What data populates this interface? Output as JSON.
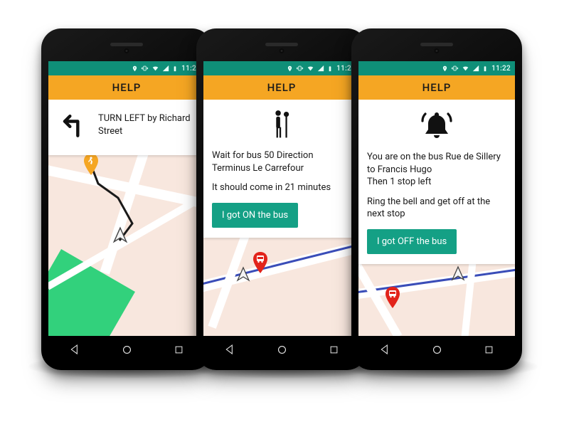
{
  "status": {
    "time": "11:22",
    "icons": [
      "pin",
      "vibrate",
      "wifi",
      "signal",
      "battery"
    ]
  },
  "appbar": {
    "title": "HELP"
  },
  "colors": {
    "statusbar": "#0f8f78",
    "appbar": "#f5a623",
    "button": "#14a085",
    "map_base": "#f8e7de",
    "park": "#32d17c",
    "route_bus": "#3a4db8"
  },
  "phones": [
    {
      "id": "turn",
      "icon": "turn-left",
      "instruction": "TURN LEFT by Richard Street",
      "button": null,
      "map_markers": [
        "walk-start",
        "cursor"
      ]
    },
    {
      "id": "wait",
      "icon": "person-stop",
      "instruction": "Wait for bus 50 Direction Terminus Le Carrefour",
      "instruction2": "It should come in 21 minutes",
      "button": "I got ON the bus",
      "map_markers": [
        "bus-stop",
        "cursor"
      ]
    },
    {
      "id": "onbus",
      "icon": "bell",
      "instruction": "You are on the bus Rue de Sillery to Francis Hugo",
      "instruction2": "Then 1 stop left",
      "instruction3": "Ring the bell and get off at the next stop",
      "button": "I got OFF the bus",
      "map_markers": [
        "cursor",
        "bus-stop"
      ]
    }
  ],
  "nav": {
    "keys": [
      "back",
      "home",
      "recents"
    ]
  }
}
